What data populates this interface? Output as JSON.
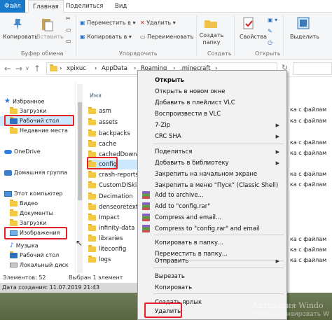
{
  "ribbon": {
    "tabs": [
      "Файл",
      "Главная",
      "Поделиться",
      "Вид"
    ],
    "clipboard": {
      "pin": "Закрепить на панели быстрого доступа",
      "copy": "Копировать",
      "paste": "Вставить",
      "group": "Буфер обмена"
    },
    "organize": {
      "move": "Переместить в ▾",
      "copy_to": "Копировать в ▾",
      "delete": "Удалить ▾",
      "rename": "Переименовать",
      "group": "Упорядочить"
    },
    "create": {
      "new_folder": "Создать папку",
      "group": "Создать"
    },
    "open": {
      "properties": "Свойства",
      "group": "Открыть"
    },
    "select": {
      "select": "Выделить"
    }
  },
  "address": {
    "crumbs": [
      "›",
      "xpixuc",
      "›",
      "AppData",
      "›",
      "Roaming",
      "›",
      ".minecraft",
      "›"
    ],
    "refresh": "↻"
  },
  "nav": {
    "items": [
      {
        "label": "Избранное",
        "icon": "star-icon"
      },
      {
        "label": "Загрузки",
        "icon": "folder-icon"
      },
      {
        "label": "Рабочий стол",
        "icon": "folder-icon"
      },
      {
        "label": "Недавние места",
        "icon": "folder-icon"
      },
      {
        "label": "OneDrive",
        "icon": "cloud-icon"
      },
      {
        "label": "Домашняя группа",
        "icon": "network-icon"
      },
      {
        "label": "Этот компьютер",
        "icon": "computer-icon"
      },
      {
        "label": "Видео",
        "icon": "folder-icon"
      },
      {
        "label": "Документы",
        "icon": "folder-icon"
      },
      {
        "label": "Загрузки",
        "icon": "folder-icon"
      },
      {
        "label": "Изображения",
        "icon": "image-icon"
      },
      {
        "label": "Музыка",
        "icon": "music-icon"
      },
      {
        "label": "Рабочий стол",
        "icon": "folder-icon"
      },
      {
        "label": "Локальный диск",
        "icon": "drive-icon"
      }
    ]
  },
  "files": {
    "column": "Имя",
    "rows": [
      "asm",
      "assets",
      "backpacks",
      "cache",
      "cachedDownlo",
      "config",
      "crash-reports",
      "CustomDISkin",
      "Decimation",
      "denseoretextur",
      "Impact",
      "infinity-data",
      "libraries",
      "liteconfig",
      "logs"
    ],
    "right_col": [
      "ка с файлам",
      "ка с файлам",
      "ка с файлам",
      "ка с файлам",
      "ка с файлам",
      "ка с файлам",
      "ка с файлам",
      "ка с файлам",
      "ка с файлам"
    ]
  },
  "status": {
    "count": "Элементов: 52",
    "selected": "Выбран 1 элемент",
    "date": "Дата создания: 11.07.2019 21:43"
  },
  "context_menu": {
    "items": [
      {
        "label": "Открыть",
        "bold": true
      },
      {
        "label": "Открыть в новом окне"
      },
      {
        "label": "Добавить в плейлист VLC"
      },
      {
        "label": "Воспроизвести в VLC"
      },
      {
        "label": "7-Zip",
        "sub": true
      },
      {
        "label": "CRC SHA",
        "sub": true
      },
      {
        "label": "Поделиться",
        "sub": true
      },
      {
        "label": "Добавить в библиотеку",
        "sub": true
      },
      {
        "label": "Закрепить на начальном экране"
      },
      {
        "label": "Закрепить в меню \"Пуск\" (Classic Shell)"
      },
      {
        "label": "Add to archive..."
      },
      {
        "label": "Add to \"config.rar\""
      },
      {
        "label": "Compress and email..."
      },
      {
        "label": "Compress to \"config.rar\" and email"
      },
      {
        "label": "Копировать в папку..."
      },
      {
        "label": "Переместить в папку..."
      },
      {
        "label": "Отправить",
        "sub": true
      },
      {
        "label": "Вырезать"
      },
      {
        "label": "Копировать"
      },
      {
        "label": "Создать ярлык"
      },
      {
        "label": "Удалить"
      }
    ]
  },
  "watermark": {
    "line1": "Активация Windo",
    "line2": "Чтобы активировать W"
  }
}
